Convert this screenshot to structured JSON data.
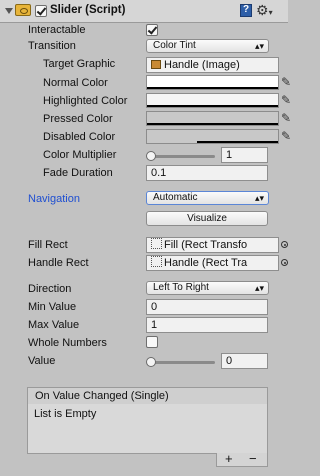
{
  "header": {
    "title": "Slider (Script)",
    "enabled": true
  },
  "fields": {
    "interactable": {
      "label": "Interactable",
      "checked": true
    },
    "transition": {
      "label": "Transition",
      "value": "Color Tint"
    },
    "target_graphic": {
      "label": "Target Graphic",
      "value": "Handle (Image)"
    },
    "normal_color": {
      "label": "Normal Color",
      "color": "#ffffff"
    },
    "highlighted_color": {
      "label": "Highlighted Color",
      "color": "#f5f5f5"
    },
    "pressed_color": {
      "label": "Pressed Color",
      "color": "#c8c8c8"
    },
    "disabled_color": {
      "label": "Disabled Color",
      "color": "#c8c8c8"
    },
    "color_multiplier": {
      "label": "Color Multiplier",
      "value": "1",
      "fraction": 0
    },
    "fade_duration": {
      "label": "Fade Duration",
      "value": "0.1"
    },
    "navigation": {
      "label": "Navigation",
      "value": "Automatic",
      "button": "Visualize"
    },
    "fill_rect": {
      "label": "Fill Rect",
      "value": "Fill (Rect Transfo"
    },
    "handle_rect": {
      "label": "Handle Rect",
      "value": "Handle (Rect Tra"
    },
    "direction": {
      "label": "Direction",
      "value": "Left To Right"
    },
    "min_value": {
      "label": "Min Value",
      "value": "0"
    },
    "max_value": {
      "label": "Max Value",
      "value": "1"
    },
    "whole_numbers": {
      "label": "Whole Numbers",
      "checked": false
    },
    "value": {
      "label": "Value",
      "value": "0",
      "fraction": 0
    }
  },
  "event": {
    "title": "On Value Changed (Single)",
    "empty_text": "List is Empty",
    "add": "+",
    "remove": "−"
  },
  "icons": {
    "foldout": "triangle-down",
    "help": "book-icon",
    "settings": "gear-icon",
    "pipette": "eyedropper-icon"
  },
  "colors": {
    "navigation_label": "#1f4fd1",
    "inspector_bg": "#c2c2c2",
    "header_bg": "#d6d6d6"
  }
}
